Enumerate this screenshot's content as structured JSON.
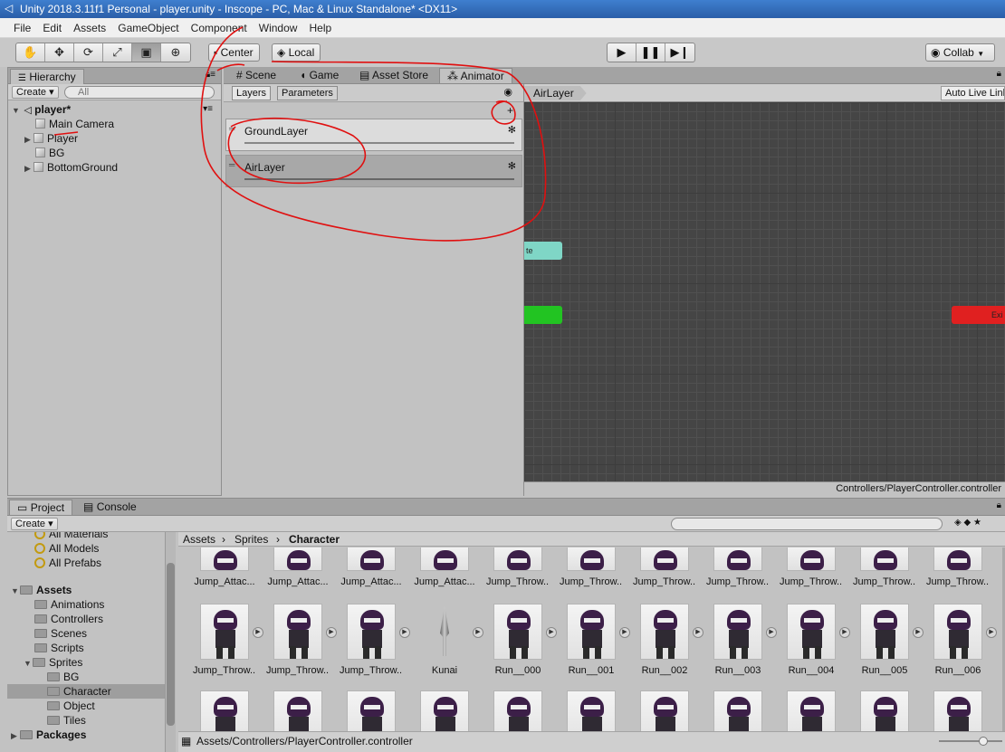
{
  "window": {
    "title": "Unity 2018.3.11f1 Personal - player.unity - Inscope - PC, Mac & Linux Standalone* <DX11>"
  },
  "menu": [
    "File",
    "Edit",
    "Assets",
    "GameObject",
    "Component",
    "Window",
    "Help"
  ],
  "toolbar": {
    "center_label": "Center",
    "local_label": "Local",
    "collab_label": "Collab"
  },
  "hierarchy": {
    "tab": "Hierarchy",
    "create": "Create",
    "search_placeholder": "All",
    "scene": "player*",
    "items": [
      "Main Camera",
      "Player",
      "BG",
      "BottomGround"
    ]
  },
  "scene_tabs": [
    "Scene",
    "Game",
    "Asset Store",
    "Animator"
  ],
  "animator": {
    "subtabs": [
      "Layers",
      "Parameters"
    ],
    "breadcrumb": "AirLayer",
    "auto_live_link": "Auto Live Link",
    "layers": [
      "GroundLayer",
      "AirLayer"
    ],
    "state_entry_partial": "te",
    "state_exit_partial": "Exi",
    "footer_path": "Controllers/PlayerController.controller"
  },
  "project": {
    "tabs": [
      "Project",
      "Console"
    ],
    "create": "Create",
    "favorites": [
      "All Materials",
      "All Models",
      "All Prefabs"
    ],
    "assets_root": "Assets",
    "folders": [
      "Animations",
      "Controllers",
      "Scenes",
      "Scripts",
      "Sprites"
    ],
    "sprite_folders": [
      "BG",
      "Character",
      "Object",
      "Tiles"
    ],
    "packages": "Packages",
    "breadcrumb": [
      "Assets",
      "Sprites",
      "Character"
    ],
    "row1": [
      "Jump_Attac...",
      "Jump_Attac...",
      "Jump_Attac...",
      "Jump_Attac...",
      "Jump_Throw...",
      "Jump_Throw...",
      "Jump_Throw...",
      "Jump_Throw...",
      "Jump_Throw...",
      "Jump_Throw...",
      "Jump_Throw..."
    ],
    "row2": [
      "Jump_Throw...",
      "Jump_Throw...",
      "Jump_Throw...",
      "Kunai",
      "Run__000",
      "Run__001",
      "Run__002",
      "Run__003",
      "Run__004",
      "Run__005",
      "Run__006"
    ],
    "footer_path": "Assets/Controllers/PlayerController.controller"
  },
  "colors": {
    "annotation": "#e01010",
    "entry_state": "#7fd6c6",
    "start_state": "#22c422",
    "exit_state": "#e02020"
  }
}
